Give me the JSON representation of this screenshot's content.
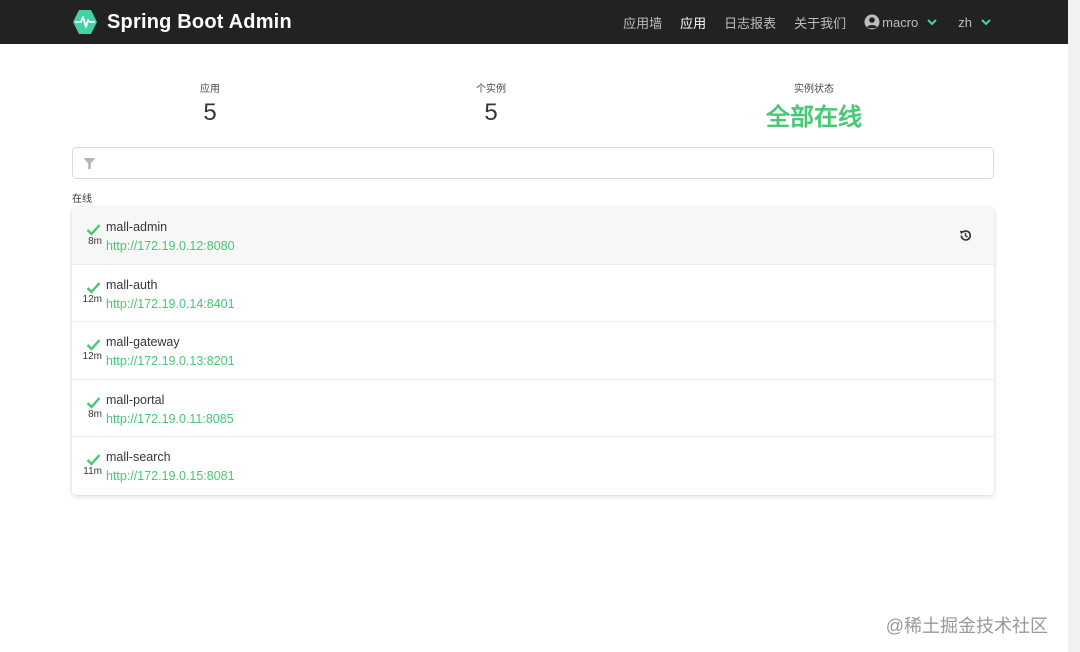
{
  "navbar": {
    "title": "Spring Boot Admin",
    "items": [
      "应用墙",
      "应用",
      "日志报表",
      "关于我们"
    ],
    "active_index": 1,
    "user": "macro",
    "lang": "zh"
  },
  "stats": {
    "apps_label": "应用",
    "apps_value": "5",
    "instances_label": "个实例",
    "instances_value": "5",
    "status_label": "实例状态",
    "status_value": "全部在线"
  },
  "filter": {
    "placeholder": ""
  },
  "group": {
    "label": "在线"
  },
  "apps": [
    {
      "name": "mall-admin",
      "since": "8m",
      "url": "http://172.19.0.12:8080"
    },
    {
      "name": "mall-auth",
      "since": "12m",
      "url": "http://172.19.0.14:8401"
    },
    {
      "name": "mall-gateway",
      "since": "12m",
      "url": "http://172.19.0.13:8201"
    },
    {
      "name": "mall-portal",
      "since": "8m",
      "url": "http://172.19.0.11:8085"
    },
    {
      "name": "mall-search",
      "since": "11m",
      "url": "http://172.19.0.15:8081"
    }
  ],
  "icons": {
    "brand": "pulse-logo-icon",
    "user": "user-circle-icon",
    "dropdown": "chevron-down-icon",
    "filter": "filter-icon",
    "status": "check-icon",
    "history": "history-icon"
  },
  "colors": {
    "accent": "#42d3a5",
    "success": "#48c774",
    "navbar": "#222222"
  },
  "watermark": "@稀土掘金技术社区"
}
